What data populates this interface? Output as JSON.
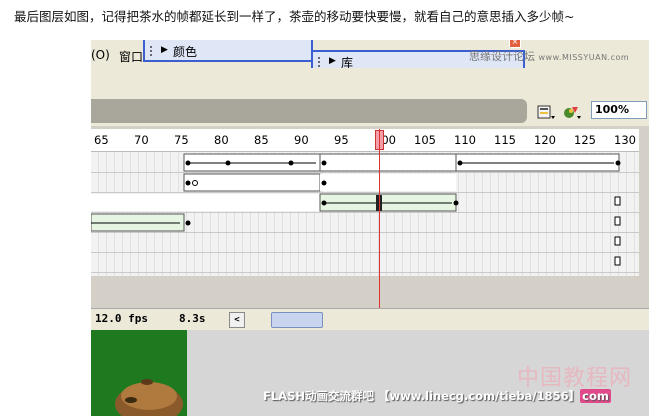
{
  "caption": "最后图层如图，记得把茶水的帧都延长到一样了，茶壶的移动要快要慢，就看自己的意思插入多少帧~",
  "menubar": {
    "items": [
      "(O)",
      "窗口"
    ],
    "panels": [
      {
        "title": "颜色"
      },
      {
        "title": "库"
      }
    ],
    "watermark": {
      "cn": "思缘设计论坛",
      "url": "www.MISSYUAN.com"
    }
  },
  "toolbar": {
    "zoom_value": "100%",
    "icons": [
      "edit-scene-icon",
      "edit-symbol-icon"
    ]
  },
  "timeline": {
    "ruler_labels": [
      "65",
      "70",
      "75",
      "80",
      "85",
      "90",
      "95",
      "100",
      "105",
      "110",
      "115",
      "120",
      "125",
      "130"
    ],
    "current_frame": 100,
    "layers_count": 6
  },
  "status": {
    "frame_rate": "12.0 fps",
    "elapsed": "8.3s",
    "scroll_left": "<"
  },
  "stage": {
    "watermark_cn": "中国教程网",
    "banner_text": "FLASH动画交流群吧 【www.linecg.com/tieba/1856】",
    "banner_suffix": "com",
    "colors": {
      "green": "#1f7a1f",
      "accent_pink": "#e04a8a"
    }
  }
}
